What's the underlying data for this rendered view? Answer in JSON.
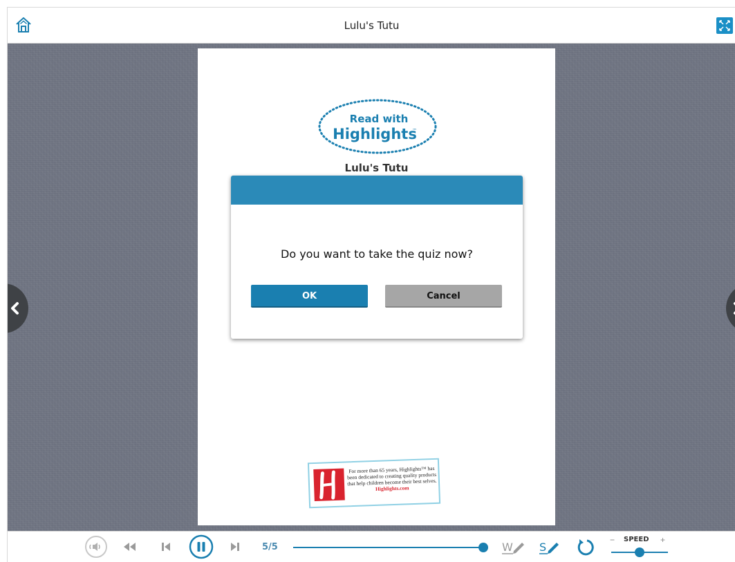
{
  "header": {
    "title": "Lulu's Tutu",
    "home_icon": "home-icon",
    "expand_icon": "expand-icon"
  },
  "book": {
    "logo_line1": "Read with",
    "logo_line2": "Highlights",
    "logo_tm": "™",
    "title": "Lulu's Tutu",
    "footer_text": "For more than 65 years, Highlights™ has been dedicated to creating quality products that help children become their best selves.",
    "footer_link": "Highlights.com"
  },
  "dialog": {
    "message": "Do you want to take the quiz now?",
    "ok_label": "OK",
    "cancel_label": "Cancel"
  },
  "toolbar": {
    "audio_icon": "speaker-icon",
    "rewind_icon": "rewind-icon",
    "prev_icon": "skip-previous-icon",
    "pause_icon": "pause-icon",
    "next_icon": "skip-next-icon",
    "page_count": "5/5",
    "progress": 1.0,
    "words_icon": "word-pencil-icon",
    "sentence_icon": "sentence-pencil-icon",
    "replay_icon": "replay-icon",
    "speed_label": "SPEED",
    "speed_minus": "−",
    "speed_plus": "+",
    "speed_level": 0.5
  },
  "colors": {
    "accent": "#1a7fb0",
    "dialog_header": "#2b8ab8",
    "cancel": "#a6a6a6",
    "stage": "#6f7482"
  }
}
